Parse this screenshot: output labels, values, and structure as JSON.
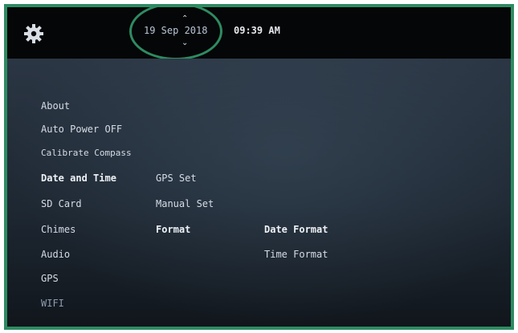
{
  "topbar": {
    "settings_icon": "gear-icon",
    "date": "19 Sep 2018",
    "time": "09:39 AM",
    "date_up_icon": "chevron-up-icon",
    "date_down_icon": "chevron-down-icon",
    "highlight_color": "#2e8b62"
  },
  "menu": {
    "column1": [
      "About",
      "Auto Power OFF",
      "Calibrate Compass",
      "Date and Time",
      "SD Card",
      "Chimes",
      "Audio",
      "GPS",
      "WIFI"
    ],
    "column2": [
      "GPS Set",
      "Manual Set",
      "Format"
    ],
    "column3": [
      "Date Format",
      "Time Format"
    ]
  },
  "colors": {
    "frame": "#2e8b62",
    "topbar": "#050607",
    "text": "#d6dce6"
  }
}
